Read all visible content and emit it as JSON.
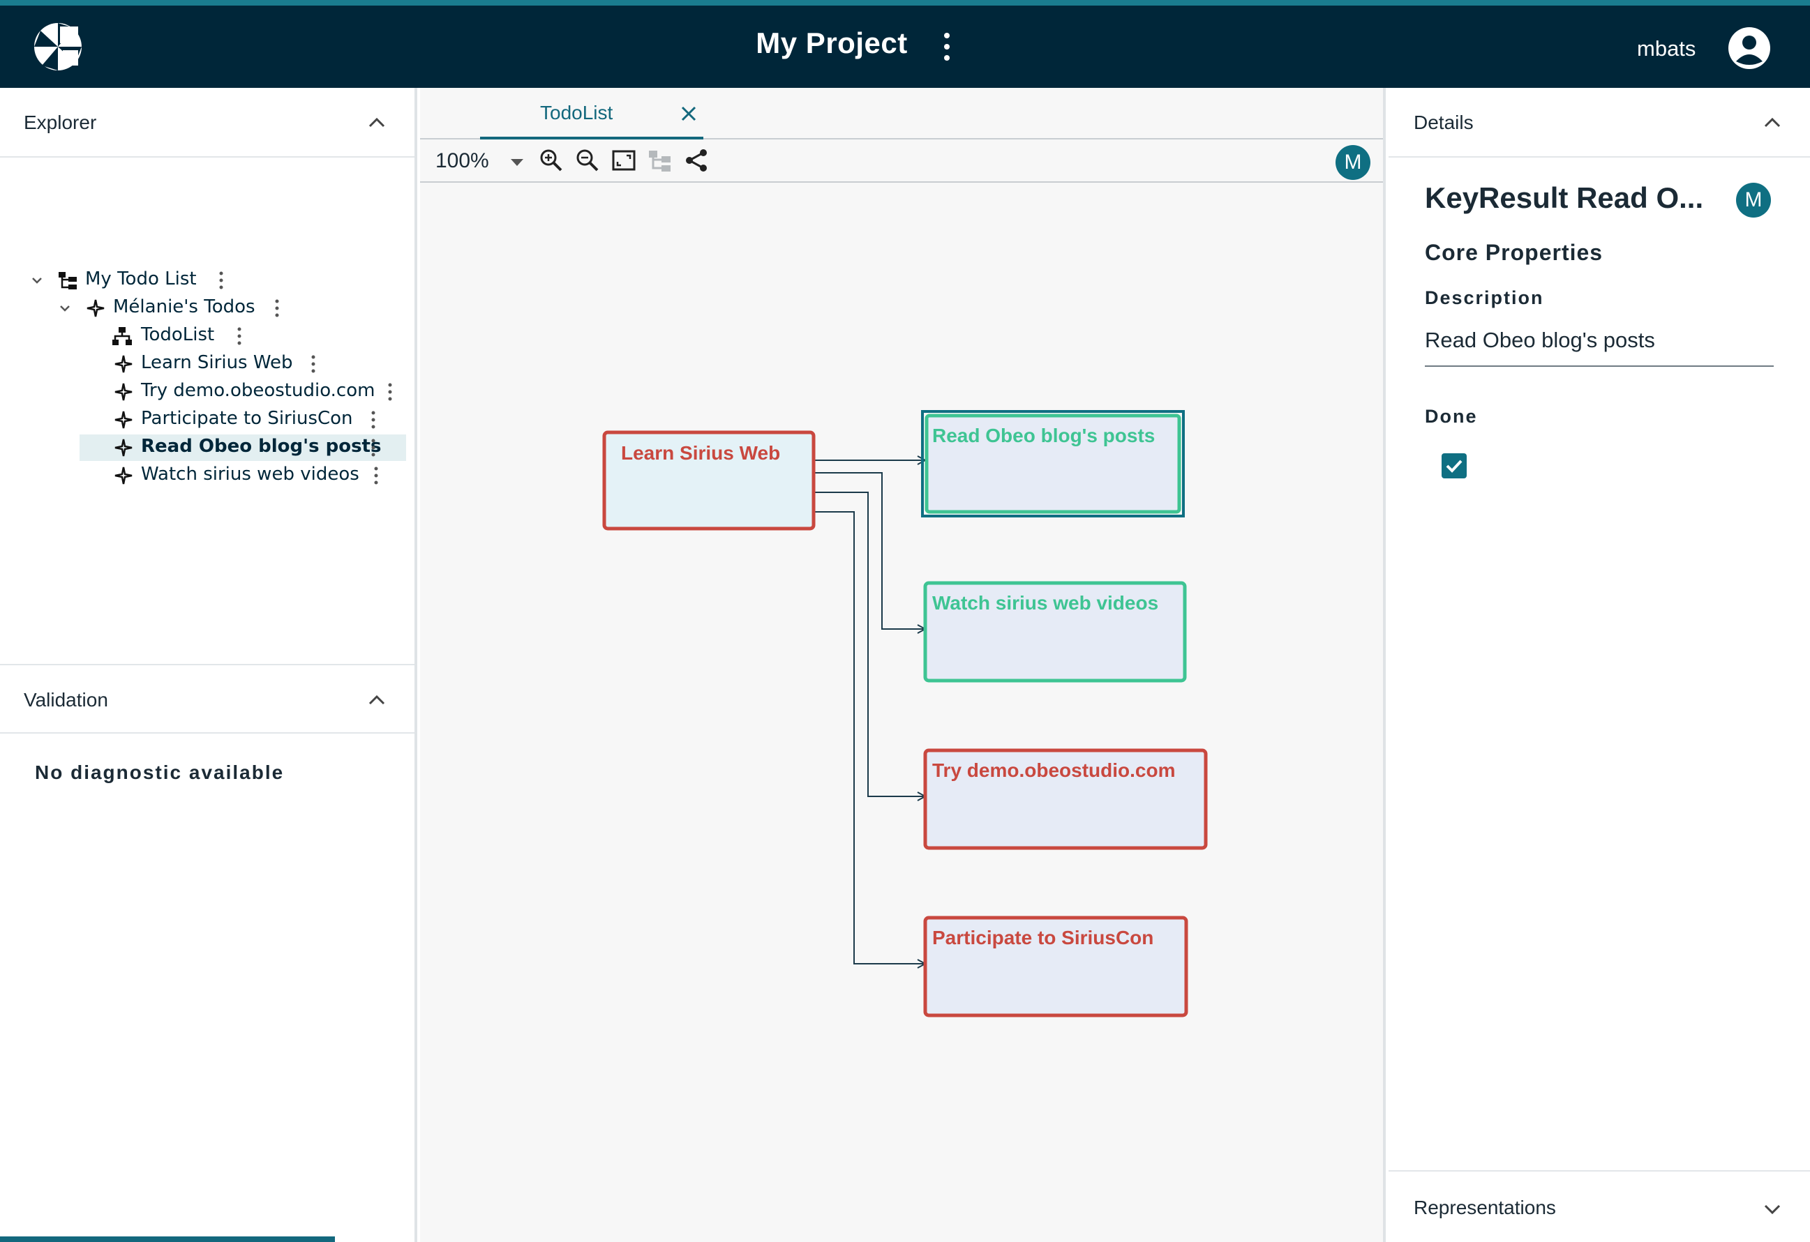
{
  "header": {
    "project_title": "My Project",
    "username": "mbats"
  },
  "explorer": {
    "title": "Explorer",
    "tree": [
      {
        "label": "My Todo List",
        "icon": "project-tree-icon"
      },
      {
        "label": "Mélanie's Todos",
        "icon": "sparkle-icon"
      },
      {
        "label": "TodoList",
        "icon": "diagram-icon"
      },
      {
        "label": "Learn Sirius Web",
        "icon": "sparkle-icon"
      },
      {
        "label": "Try demo.obeostudio.com",
        "icon": "sparkle-icon"
      },
      {
        "label": "Participate to SiriusCon",
        "icon": "sparkle-icon"
      },
      {
        "label": "Read Obeo blog's posts",
        "icon": "sparkle-icon",
        "selected": true
      },
      {
        "label": "Watch sirius web videos",
        "icon": "sparkle-icon"
      }
    ]
  },
  "validation": {
    "title": "Validation",
    "message": "No diagnostic available"
  },
  "editor": {
    "tab_label": "TodoList",
    "zoom_level": "100%",
    "avatar_initial": "M",
    "diagram": {
      "nodes": [
        {
          "label": "Learn Sirius Web",
          "color": "#c9483f"
        },
        {
          "label": "Read Obeo blog's posts",
          "color": "#3ec493",
          "selected": true
        },
        {
          "label": "Watch sirius web videos",
          "color": "#3ec493"
        },
        {
          "label": "Try demo.obeostudio.com",
          "color": "#c9483f"
        },
        {
          "label": "Participate to SiriusCon",
          "color": "#c9483f"
        }
      ]
    }
  },
  "details": {
    "title": "Details",
    "object_title": "KeyResult Read O...",
    "avatar_initial": "M",
    "section_title": "Core Properties",
    "description_label": "Description",
    "description_value": "Read Obeo blog's posts",
    "done_label": "Done",
    "done_checked": true
  },
  "representations": {
    "title": "Representations"
  },
  "colors": {
    "header_bg": "#002639",
    "accent": "#0f6f82",
    "red_node": "#c9483f",
    "green_node": "#3ec493",
    "node_fill": "#e6ebf6"
  }
}
